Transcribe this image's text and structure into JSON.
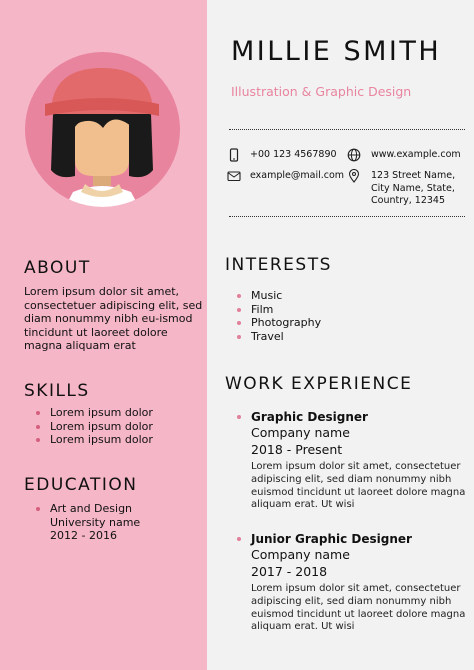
{
  "profile": {
    "name": "MILLIE SMITH",
    "title": "Illustration & Graphic Design"
  },
  "contact": {
    "phone": "+00 123 4567890",
    "email": "example@mail.com",
    "website": "www.example.com",
    "address": "123 Street Name, City Name, State, Country, 12345"
  },
  "about": {
    "heading": "ABOUT",
    "text": "Lorem ipsum dolor sit amet, consectetuer adipiscing elit, sed diam nonummy nibh eu-ismod tincidunt ut laoreet dolore magna aliquam erat"
  },
  "skills": {
    "heading": "SKILLS",
    "items": [
      "Lorem ipsum dolor",
      "Lorem ipsum dolor",
      "Lorem ipsum dolor"
    ]
  },
  "education": {
    "heading": "EDUCATION",
    "degree": "Art and Design",
    "school": "University name",
    "years": "2012 - 2016"
  },
  "interests": {
    "heading": "INTERESTS",
    "items": [
      "Music",
      "Film",
      "Photography",
      "Travel"
    ]
  },
  "work": {
    "heading": "WORK EXPERIENCE",
    "jobs": [
      {
        "role": "Graphic Designer",
        "company": "Company name",
        "dates": "2018 - Present",
        "description": "Lorem ipsum dolor sit amet, consectetuer adipiscing elit, sed diam nonummy nibh euismod tincidunt ut laoreet dolore magna aliquam erat. Ut wisi"
      },
      {
        "role": "Junior Graphic Designer",
        "company": "Company name",
        "dates": "2017 - 2018",
        "description": "Lorem ipsum dolor sit amet, consectetuer adipiscing elit, sed diam nonummy nibh euismod tincidunt ut laoreet dolore magna aliquam erat. Ut wisi"
      }
    ]
  },
  "colors": {
    "sidebar": "#f5b6c7",
    "accent": "#e9849f",
    "page": "#f2f2f2"
  },
  "icons": [
    "avatar-illustration",
    "phone-icon",
    "email-icon",
    "globe-icon",
    "location-pin-icon"
  ]
}
